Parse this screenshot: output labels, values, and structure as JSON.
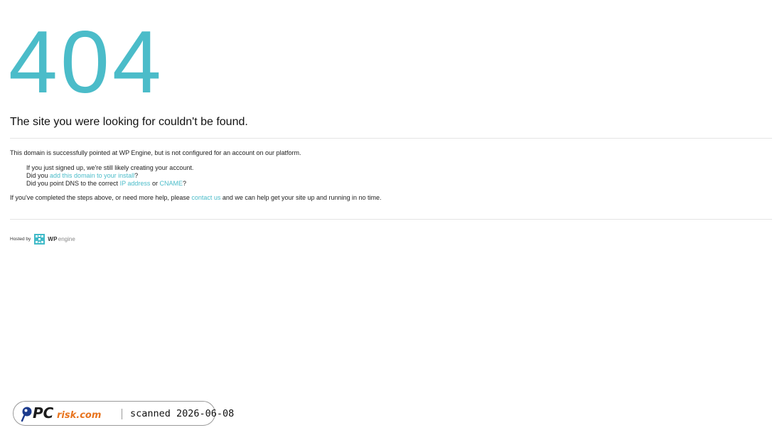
{
  "error": {
    "code": "404",
    "headline": "The site you were looking for couldn't be found."
  },
  "intro": "This domain is successfully pointed at WP Engine, but is not configured for an account on our platform.",
  "steps": {
    "item1": "If you just signed up, we're still likely creating your account.",
    "item2_prefix": "Did you ",
    "item2_link": "add this domain to your install",
    "item2_suffix": "?",
    "item3_prefix": "Did you point DNS to the correct ",
    "item3_link1": "IP address",
    "item3_mid": " or ",
    "item3_link2": "CNAME",
    "item3_suffix": "?"
  },
  "help": {
    "prefix": "If you've completed the steps above, or need more help, please ",
    "link": "contact us",
    "suffix": " and we can help get your site up and running in no time."
  },
  "footer": {
    "hosted_by": "Hosted by",
    "logo_wp": "WP",
    "logo_engine": "engine"
  },
  "watermark": {
    "logo_text": "PCrisk.com",
    "scan_text": "scanned 2026-06-08"
  },
  "colors": {
    "accent": "#4bbcc9",
    "text": "#222222",
    "rule": "#e4e4e4"
  },
  "icons": {
    "wpengine_logo": "wpengine-grid-icon",
    "pcrisk_logo": "magnifier-icon"
  }
}
